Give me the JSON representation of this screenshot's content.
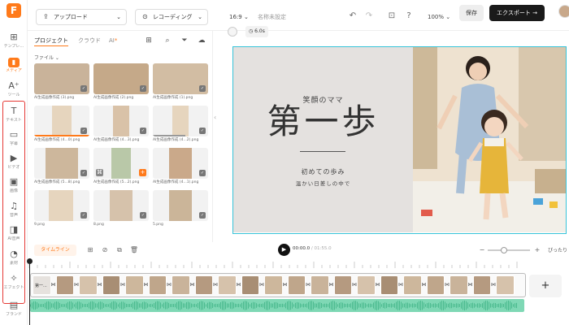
{
  "app": {
    "brand_color": "#ff7a1a",
    "logo": "F"
  },
  "rail": {
    "items": [
      {
        "icon": "template-icon",
        "label": "テンプレ…"
      },
      {
        "icon": "media-icon",
        "label": "メディア",
        "active": true
      },
      {
        "icon": "ai-tools-icon",
        "label": "ツール"
      },
      {
        "icon": "text-icon",
        "label": "テキスト"
      },
      {
        "icon": "subtitle-icon",
        "label": "字幕"
      },
      {
        "icon": "video-icon",
        "label": "ビデオ"
      },
      {
        "icon": "image-icon",
        "label": "画像"
      },
      {
        "icon": "music-icon",
        "label": "音声"
      },
      {
        "icon": "ai-voice-icon",
        "label": "AI音声"
      },
      {
        "icon": "elements-icon",
        "label": "素材"
      },
      {
        "icon": "effects-icon",
        "label": "エフェクト"
      },
      {
        "icon": "brand-icon",
        "label": "ブランド"
      }
    ]
  },
  "topbar": {
    "upload_label": "アップロード",
    "record_label": "レコーディング",
    "aspect": "16:9",
    "project_name": "名称未設定",
    "zoom": "100%",
    "save_label": "保存",
    "export_label": "エクスポート"
  },
  "panel": {
    "tabs": [
      "プロジェクト",
      "クラウド",
      "AI"
    ],
    "file_filter": "ファイル",
    "items": [
      {
        "caption": "AI生成画像作成 (3).png"
      },
      {
        "caption": "AI生成画像作成 (2).png"
      },
      {
        "caption": "AI生成画像作成 (1).png"
      },
      {
        "caption": "AI生成画像作成 (4...0).png"
      },
      {
        "caption": "AI生成画像作成 (4...3).png"
      },
      {
        "caption": "AI生成画像作成 (4...2).png"
      },
      {
        "caption": "AI生成画像作成 (5...8).png"
      },
      {
        "caption": "AI生成画像作成 (5...2).png"
      },
      {
        "caption": "AI生成画像作成 (4...1).png"
      },
      {
        "caption": "9.png"
      },
      {
        "caption": "8.png"
      },
      {
        "caption": "5.png"
      }
    ]
  },
  "preview": {
    "duration": "6.0s",
    "title_small": "笑顔のママ",
    "title_big": "第一歩",
    "line1": "初めての歩み",
    "line2": "温かい日差しの中で"
  },
  "timeline": {
    "tab_label": "タイムライン",
    "current_time": "00:00.0",
    "total_time": "01:55.0",
    "fit_label": "ぴったり",
    "clip_labels": [
      "第一...",
      "",
      "",
      "",
      "",
      "",
      "",
      "",
      "",
      "",
      "",
      "",
      "",
      "",
      "",
      "",
      "",
      "",
      "",
      "",
      ""
    ]
  }
}
